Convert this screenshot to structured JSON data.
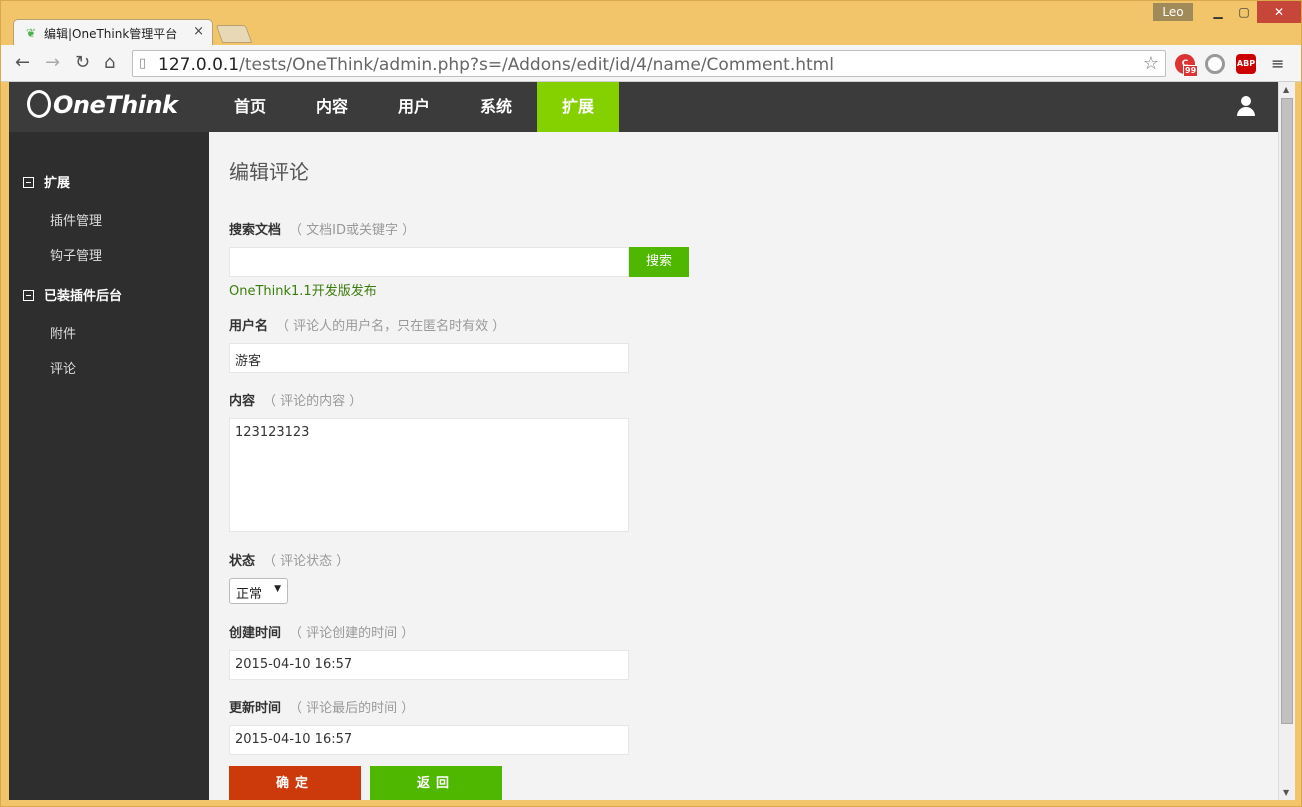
{
  "browser": {
    "tab_title": "编辑|OneThink管理平台",
    "user_badge": "Leo",
    "url_host": "127.0.0.1",
    "url_path": "/tests/OneThink/admin.php?s=/Addons/edit/id/4/name/Comment.html",
    "ext_badge_count": "99",
    "ext_abp": "ABP"
  },
  "app": {
    "logo": "OneThink",
    "nav": [
      "首页",
      "内容",
      "用户",
      "系统",
      "扩展"
    ],
    "active_nav": "扩展",
    "sidebar": {
      "group1": "扩展",
      "group1_items": [
        "插件管理",
        "钩子管理"
      ],
      "group2": "已装插件后台",
      "group2_items": [
        "附件",
        "评论"
      ]
    }
  },
  "form": {
    "title": "编辑评论",
    "search_label": "搜索文档",
    "search_hint": "（ 文档ID或关键字 ）",
    "search_value": "",
    "search_button": "搜索",
    "search_result": "OneThink1.1开发版发布",
    "username_label": "用户名",
    "username_hint": "（ 评论人的用户名，只在匿名时有效 ）",
    "username_value": "游客",
    "content_label": "内容",
    "content_hint": "（ 评论的内容 ）",
    "content_value": "123123123",
    "status_label": "状态",
    "status_hint": "（ 评论状态 ）",
    "status_value": "正常",
    "created_label": "创建时间",
    "created_hint": "（ 评论创建的时间 ）",
    "created_value": "2015-04-10 16:57",
    "updated_label": "更新时间",
    "updated_hint": "（ 评论最后的时间 ）",
    "updated_value": "2015-04-10 16:57",
    "ok_button": "确定",
    "back_button": "返回"
  }
}
